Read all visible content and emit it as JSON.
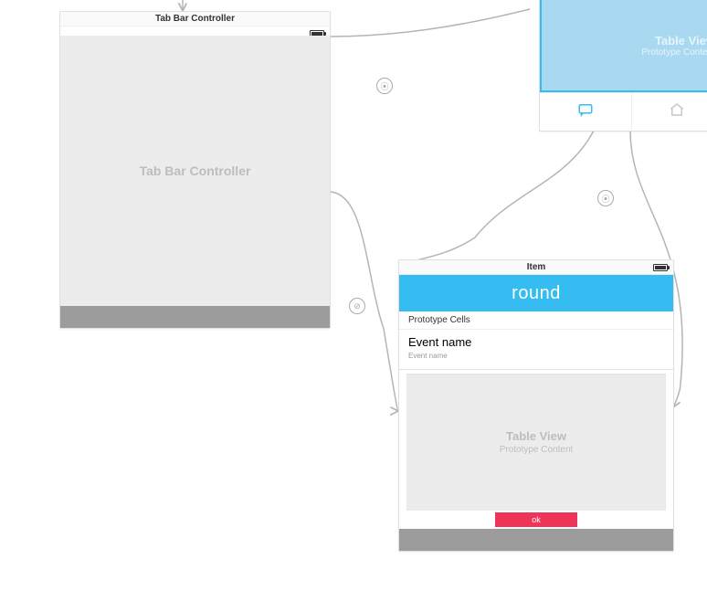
{
  "scene_left": {
    "title": "Tab Bar Controller",
    "body_label": "Tab Bar Controller"
  },
  "scene_partial": {
    "table_view_label": "Table View",
    "prototype_content_label": "Prototype Content"
  },
  "scene_item": {
    "title": "Item",
    "navbar_title": "round",
    "prototype_cells_label": "Prototype Cells",
    "cell_title": "Event name",
    "cell_subtitle": "Event name",
    "table_view_label": "Table View",
    "prototype_content_label": "Prototype Content",
    "red_button_label": "ok"
  },
  "colors": {
    "accent_blue": "#35bdf2",
    "accent_red": "#ee3559"
  }
}
